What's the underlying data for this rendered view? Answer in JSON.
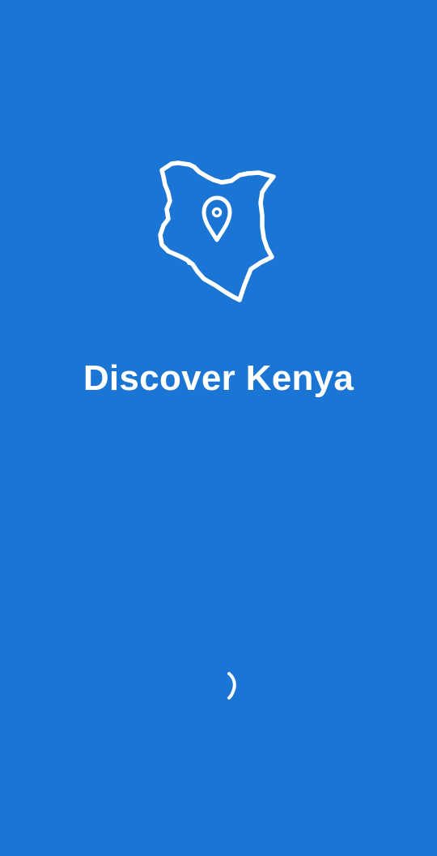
{
  "app": {
    "title": "Discover Kenya"
  },
  "logo": {
    "icon": "kenya-map-pin-icon"
  },
  "loading": {
    "icon": "loading-spinner-icon"
  },
  "colors": {
    "background": "#1b75d4",
    "foreground": "#ffffff"
  }
}
